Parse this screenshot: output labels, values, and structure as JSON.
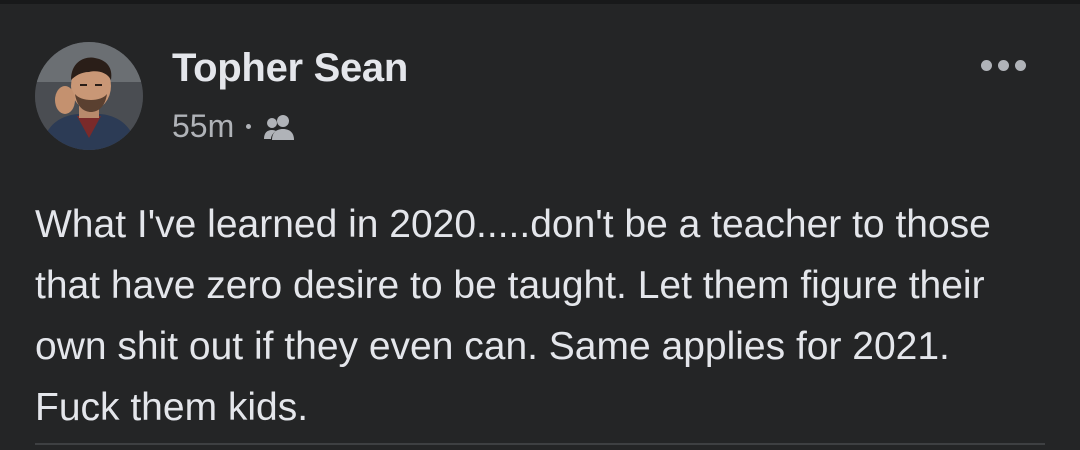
{
  "post": {
    "author_name": "Topher Sean",
    "timestamp": "55m",
    "audience_icon": "friends-icon",
    "more_icon": "more-options-icon",
    "body": "What I've learned in 2020.....don't be a teacher to those that have zero desire to be taught. Let them figure their own shit out if they even can. Same applies for 2021. Fuck them kids."
  },
  "colors": {
    "background": "#242526",
    "text_primary": "#e4e6eb",
    "text_secondary": "#b0b3b8",
    "divider": "#3e4042"
  }
}
